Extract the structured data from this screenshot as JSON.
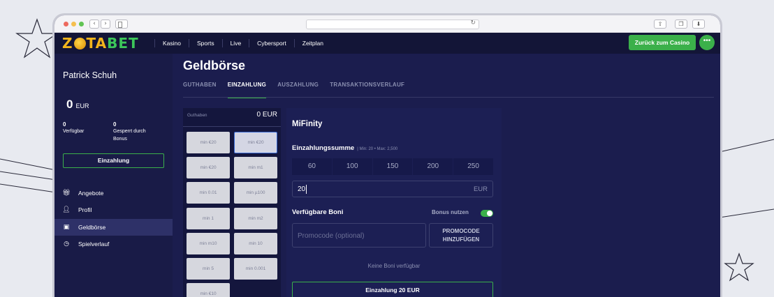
{
  "site": {
    "logo_left": "Z",
    "logo_mid": "TA",
    "logo_right": "BET"
  },
  "topnav": {
    "items": [
      "Kasino",
      "Sports",
      "Live",
      "Cybersport",
      "Zeitplan"
    ],
    "back_label": "Zurück zum Casino",
    "chat_icon": "chat-dots-icon"
  },
  "sidebar": {
    "user_name": "Patrick Schuh",
    "balance_value": "0",
    "balance_currency": "EUR",
    "available_value": "0",
    "available_label": "Verfügbar",
    "locked_value": "0",
    "locked_label_1": "Gesperrt durch",
    "locked_label_2": "Bonus",
    "deposit_label": "Einzahlung",
    "menu": [
      {
        "label": "Angebote",
        "icon": "gift-icon"
      },
      {
        "label": "Profil",
        "icon": "user-icon"
      },
      {
        "label": "Geldbörse",
        "icon": "wallet-icon",
        "active": true
      },
      {
        "label": "Spielverlauf",
        "icon": "clock-icon"
      }
    ]
  },
  "main": {
    "title": "Geldbörse",
    "tabs": [
      {
        "label": "GUTHABEN"
      },
      {
        "label": "EINZAHLUNG",
        "active": true
      },
      {
        "label": "AUSZAHLUNG"
      },
      {
        "label": "TRANSAKTIONSVERLAUF"
      }
    ]
  },
  "methods": {
    "header_label": "Guthaben",
    "header_value": "0 EUR",
    "items": [
      "min €20",
      "min €20",
      "min €20",
      "min m1",
      "min 0.01",
      "min µ100",
      "min 1",
      "min m2",
      "min m10",
      "min 10",
      "min 5",
      "min 0.001",
      "min €10"
    ],
    "selected_index": 1
  },
  "deposit_form": {
    "method_name": "MiFinity",
    "amount_label": "Einzahlungssumme",
    "amount_range": "| Min: 20 • Max: 2,500",
    "presets": [
      "60",
      "100",
      "150",
      "200",
      "250"
    ],
    "amount_value": "20",
    "amount_currency": "EUR",
    "boni_label": "Verfügbare Boni",
    "bonus_toggle_label": "Bonus nutzen",
    "bonus_toggle_on": true,
    "promo_placeholder": "Promocode (optional)",
    "promo_button_line1": "PROMOCODE",
    "promo_button_line2": "HINZUFÜGEN",
    "no_boni_text": "Keine Boni verfügbar",
    "submit_label": "Einzahlung 20 EUR"
  },
  "colors": {
    "accent_green": "#3bb04a",
    "logo_gold": "#f3b51c",
    "page_bg": "#1b1d4e",
    "sidebar_active": "#2e3168"
  }
}
